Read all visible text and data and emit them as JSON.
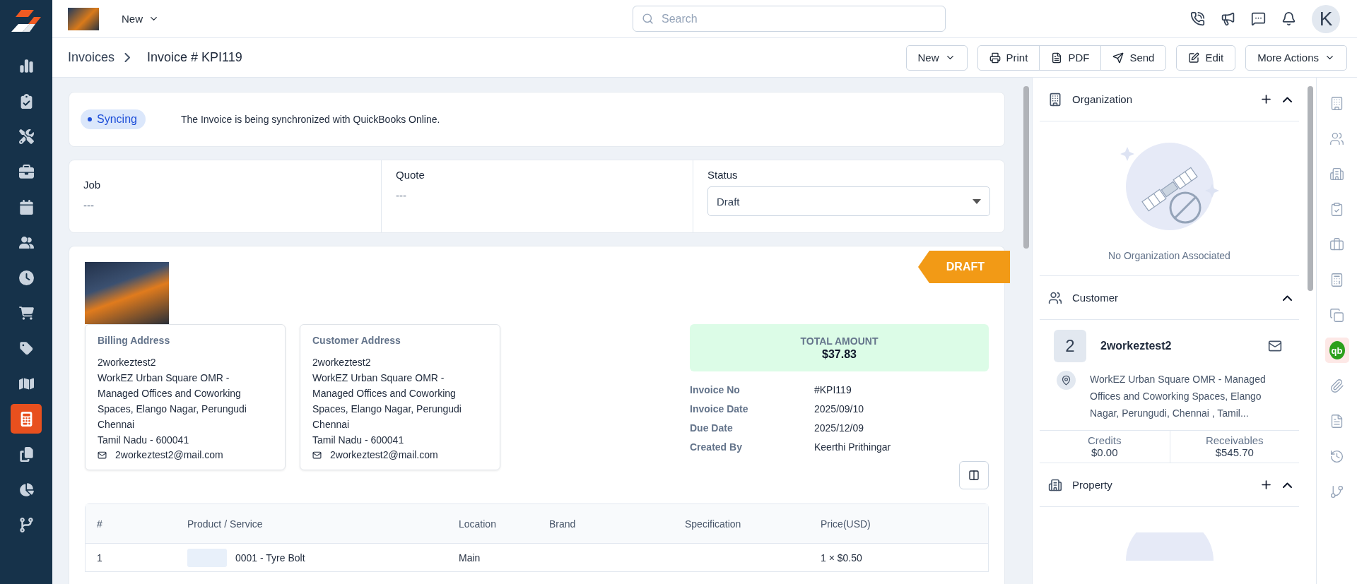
{
  "sidebar": {
    "items": [
      {
        "selected": false
      },
      {
        "selected": false
      },
      {
        "selected": false
      },
      {
        "selected": false
      },
      {
        "selected": false
      },
      {
        "selected": false
      },
      {
        "selected": false
      },
      {
        "selected": false
      },
      {
        "selected": false
      },
      {
        "selected": false
      },
      {
        "selected": true
      },
      {
        "selected": false
      },
      {
        "selected": false
      },
      {
        "selected": false
      }
    ]
  },
  "topbar": {
    "menu": "New",
    "search": {
      "placeholder": "Search"
    },
    "avatar": "K"
  },
  "breadcrumb": [
    "Invoices",
    "Invoice # KPI119"
  ],
  "actions": [
    {
      "label": "New",
      "kind": "dropdown"
    },
    {
      "label": "Print",
      "kind": "group"
    },
    {
      "label": "PDF",
      "kind": "group"
    },
    {
      "label": "Send",
      "kind": "group"
    },
    {
      "label": "Edit",
      "kind": "single"
    },
    {
      "label": "More Actions",
      "kind": "dropdown"
    }
  ],
  "sync": {
    "badge": "Syncing",
    "message": "The Invoice is being synchronized with QuickBooks Online."
  },
  "fields": [
    {
      "label": "Job",
      "value": "---"
    },
    {
      "label": "Quote",
      "value": "---"
    }
  ],
  "status": {
    "label": "Status",
    "value": "Draft"
  },
  "invoice": {
    "ribbon": "DRAFT",
    "addresses": [
      {
        "title": "Billing Address",
        "lines": [
          "2workeztest2",
          "WorkEZ Urban Square OMR - Managed Offices and Coworking Spaces, Elango Nagar, Perungudi",
          "Chennai",
          "Tamil Nadu - 600041"
        ],
        "email": "2workeztest2@mail.com"
      },
      {
        "title": "Customer Address",
        "lines": [
          "2workeztest2",
          "WorkEZ Urban Square OMR - Managed Offices and Coworking Spaces, Elango Nagar, Perungudi",
          "Chennai",
          "Tamil Nadu - 600041"
        ],
        "email": "2workeztest2@mail.com"
      }
    ],
    "total": {
      "label": "TOTAL AMOUNT",
      "value": "$37.83"
    },
    "details": [
      {
        "label": "Invoice No",
        "value": "#KPI119"
      },
      {
        "label": "Invoice Date",
        "value": "2025/09/10"
      },
      {
        "label": "Due Date",
        "value": "2025/12/09"
      },
      {
        "label": "Created By",
        "value": "Keerthi Prithingar"
      }
    ]
  },
  "table": {
    "columns": [
      "#",
      "Product / Service",
      "Location",
      "Brand",
      "Specification",
      "Price(USD)"
    ],
    "rows": [
      {
        "number": "1",
        "product": "0001 - Tyre Bolt",
        "location": "Main",
        "price": "1 × $0.50"
      }
    ]
  },
  "panel": {
    "organization": {
      "title": "Organization",
      "expanded": true,
      "empty_text": "No Organization Associated"
    },
    "customer": {
      "title": "Customer",
      "expanded": true,
      "initial": "2",
      "name": "2workeztest2",
      "address": "WorkEZ Urban Square OMR - Managed Offices and Coworking Spaces, Elango Nagar, Perungudi, Chennai , Tamil...",
      "stats": [
        {
          "label": "Credits",
          "value": "$0.00"
        },
        {
          "label": "Receivables",
          "value": "$545.70"
        }
      ]
    },
    "property": {
      "title": "Property",
      "expanded": true
    }
  },
  "rail": {
    "items": [
      {
        "kind": "icon",
        "selected": false
      },
      {
        "kind": "icon",
        "selected": false
      },
      {
        "kind": "icon",
        "selected": false
      },
      {
        "kind": "icon",
        "selected": false
      },
      {
        "kind": "icon",
        "selected": false
      },
      {
        "kind": "icon",
        "selected": false
      },
      {
        "kind": "icon",
        "selected": false
      },
      {
        "kind": "logo",
        "label": "qb",
        "selected": true
      },
      {
        "kind": "icon",
        "selected": false
      },
      {
        "kind": "icon",
        "selected": false
      },
      {
        "kind": "icon",
        "selected": false
      },
      {
        "kind": "icon",
        "selected": false
      }
    ]
  }
}
